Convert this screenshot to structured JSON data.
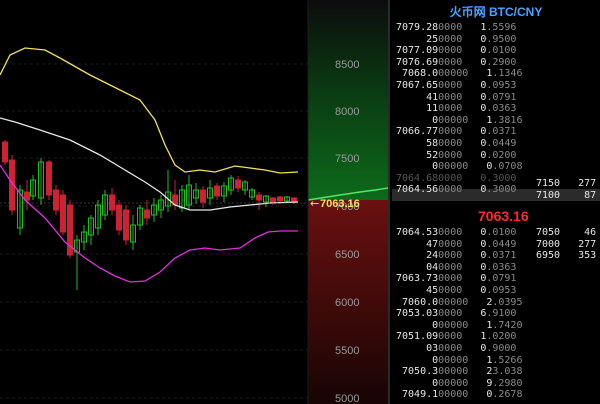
{
  "title": "火币网 BTC/CNY",
  "last_price": "7063.16",
  "current_label": "7063.16",
  "y_axis": [
    "8500",
    "8000",
    "7500",
    "7000",
    "6500",
    "6000",
    "5500",
    "5000"
  ],
  "asks": [
    {
      "price": "7079.28",
      "pdim": "0000",
      "qty": "1.5596"
    },
    {
      "price": "25",
      "pdim": "0000",
      "qty": "0.9500"
    },
    {
      "price": "7077.09",
      "pdim": "0000",
      "qty": "0.0100"
    },
    {
      "price": "7076.69",
      "pdim": "0000",
      "qty": "0.2900"
    },
    {
      "price": "7068.0",
      "pdim": "00000",
      "qty": "1.1346"
    },
    {
      "price": "7067.65",
      "pdim": "0000",
      "qty": "0.0953"
    },
    {
      "price": "41",
      "pdim": "0000",
      "qty": "0.0791"
    },
    {
      "price": "11",
      "pdim": "0000",
      "qty": "0.0363"
    },
    {
      "price": "0",
      "pdim": "00000",
      "qty": "1.3816"
    },
    {
      "price": "7066.77",
      "pdim": "0000",
      "qty": "0.0371"
    },
    {
      "price": "58",
      "pdim": "0000",
      "qty": "0.0449"
    },
    {
      "price": "52",
      "pdim": "0000",
      "qty": "0.0200"
    },
    {
      "price": "0",
      "pdim": "00000",
      "qty": "0.0708"
    },
    {
      "price": "7064.68",
      "pdim": "0000",
      "qty": "0.3000",
      "faint": true
    },
    {
      "price": "7064.56",
      "pdim": "0000",
      "qty": "0.3000",
      "hl": true
    }
  ],
  "bids": [
    {
      "price": "7064.53",
      "pdim": "0000",
      "qty": "0.0100"
    },
    {
      "price": "47",
      "pdim": "0000",
      "qty": "0.0449"
    },
    {
      "price": "24",
      "pdim": "0000",
      "qty": "0.0371"
    },
    {
      "price": "04",
      "pdim": "0000",
      "qty": "0.0363"
    },
    {
      "price": "7063.73",
      "pdim": "0000",
      "qty": "0.0791"
    },
    {
      "price": "45",
      "pdim": "0000",
      "qty": "0.0953"
    },
    {
      "price": "7060.0",
      "pdim": "00000",
      "qty": "2.0395"
    },
    {
      "price": "7053.03",
      "pdim": "0000",
      "qty": "6.9100"
    },
    {
      "price": "0",
      "pdim": "00000",
      "qty": "1.7420"
    },
    {
      "price": "7051.09",
      "pdim": "0000",
      "qty": "1.0200"
    },
    {
      "price": "03",
      "pdim": "0000",
      "qty": "0.9000"
    },
    {
      "price": "0",
      "pdim": "00000",
      "qty": "1.5266"
    },
    {
      "price": "7050.3",
      "pdim": "00000",
      "qty": "23.038"
    },
    {
      "price": "0",
      "pdim": "00000",
      "qty": "9.2980"
    },
    {
      "price": "7049.1",
      "pdim": "00000",
      "qty": "0.2678"
    }
  ],
  "agg_asks": [
    {
      "price": "7150",
      "amt": "277"
    },
    {
      "price": "7100",
      "amt": "87"
    }
  ],
  "agg_bids": [
    {
      "price": "7050",
      "amt": "46"
    },
    {
      "price": "7000",
      "amt": "277"
    },
    {
      "price": "6950",
      "amt": "353"
    }
  ],
  "colors": {
    "up": "#22bb22",
    "down": "#cc2233",
    "ma_yellow": "#f0e060",
    "ma_white": "#e8e8e8",
    "ma_magenta": "#e030e0"
  }
}
